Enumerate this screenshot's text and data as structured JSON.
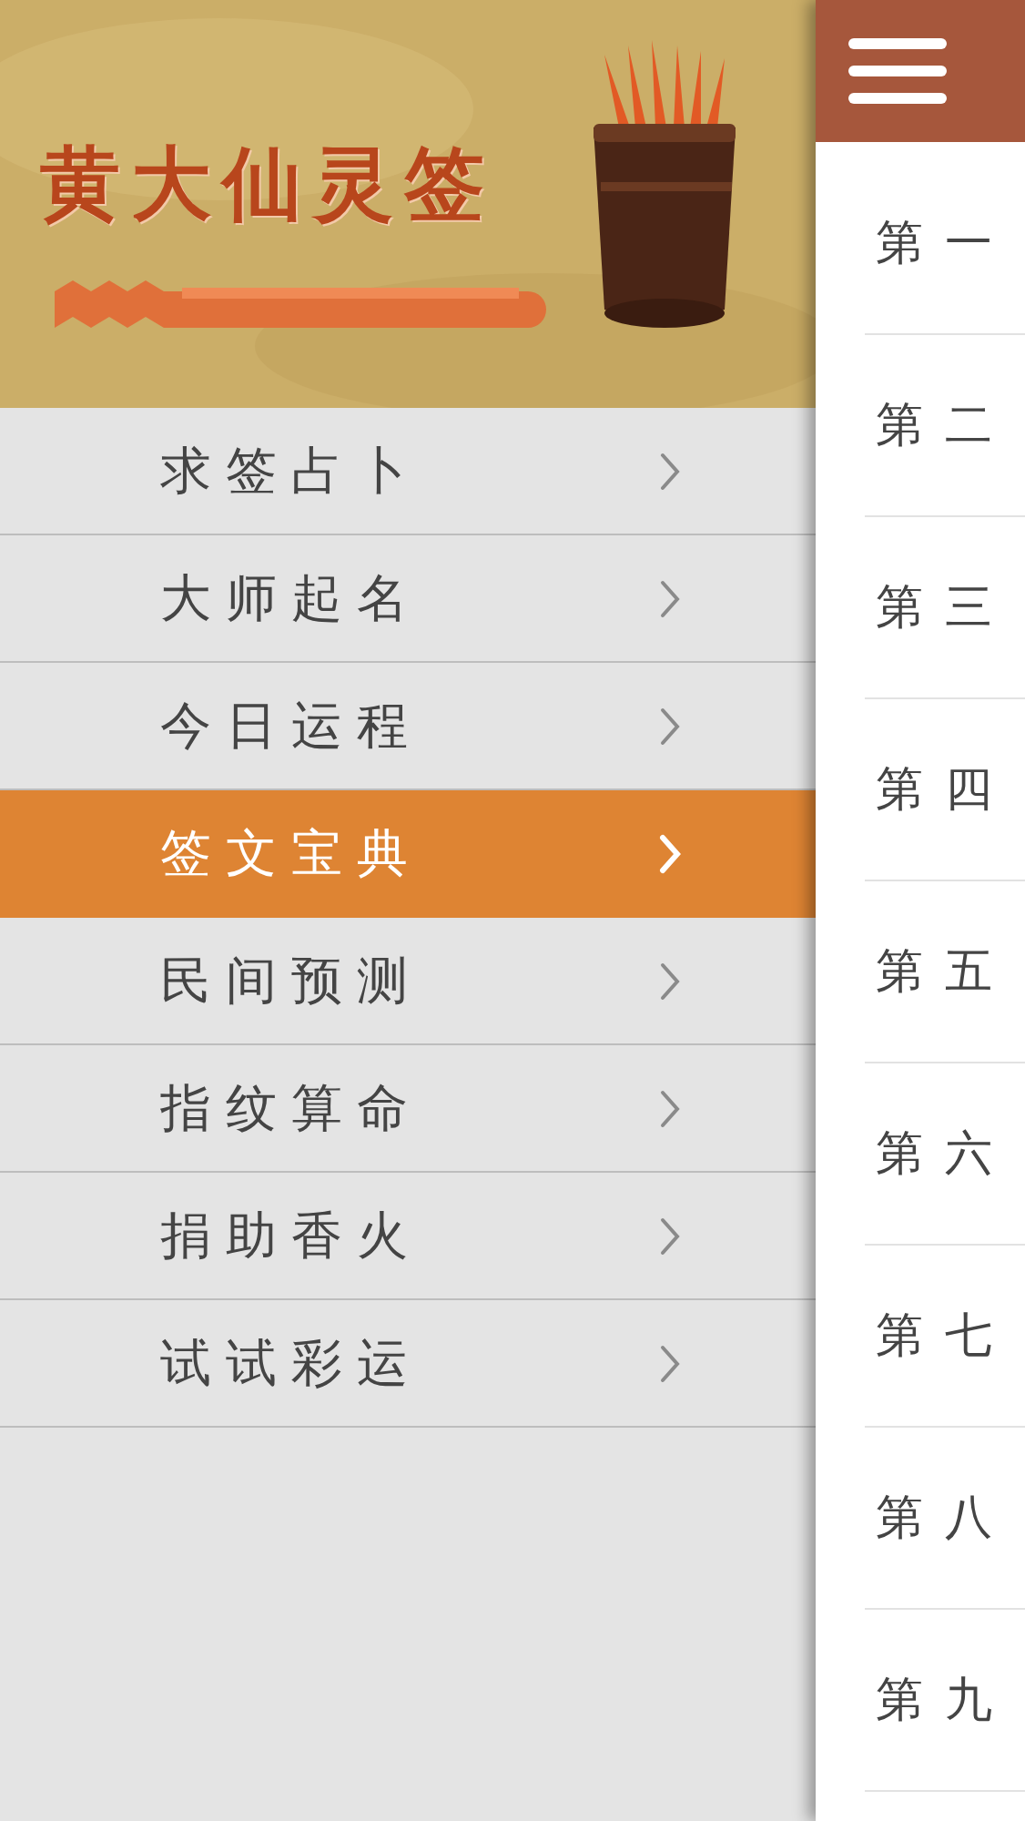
{
  "drawer": {
    "banner": {
      "title": "黄大仙灵签",
      "kind": "picture"
    },
    "menu": [
      {
        "label": "求签占卜",
        "selected": false
      },
      {
        "label": "大师起名",
        "selected": false
      },
      {
        "label": "今日运程",
        "selected": false
      },
      {
        "label": "签文宝典",
        "selected": true
      },
      {
        "label": "民间预测",
        "selected": false
      },
      {
        "label": "指纹算命",
        "selected": false
      },
      {
        "label": "捐助香火",
        "selected": false
      },
      {
        "label": "试试彩运",
        "selected": false
      }
    ]
  },
  "main": {
    "list": [
      {
        "label": "第一"
      },
      {
        "label": "第二"
      },
      {
        "label": "第三"
      },
      {
        "label": "第四"
      },
      {
        "label": "第五"
      },
      {
        "label": "第六"
      },
      {
        "label": "第七"
      },
      {
        "label": "第八"
      },
      {
        "label": "第九"
      }
    ]
  }
}
